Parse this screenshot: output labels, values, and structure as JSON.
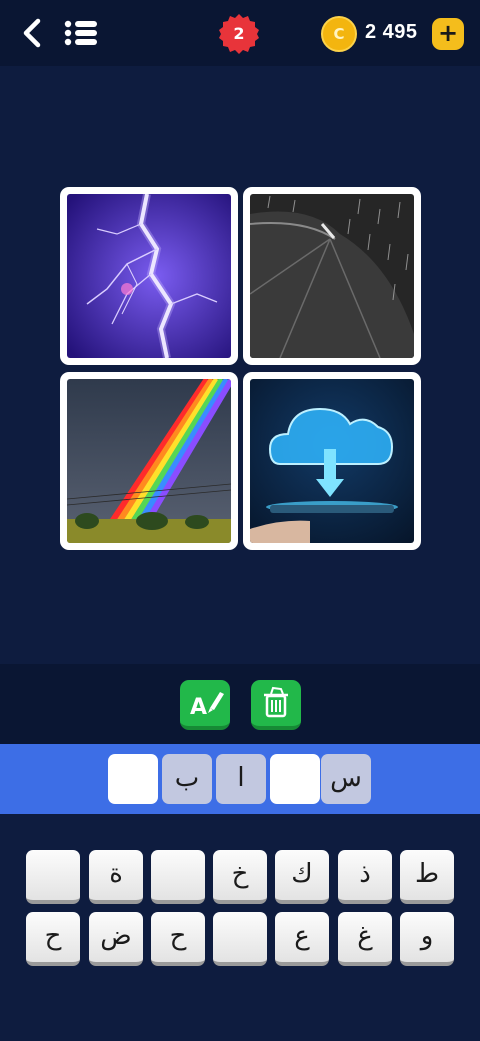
{
  "header": {
    "level": "2",
    "coins": "2 495",
    "plus_label": "+",
    "coin_symbol": "C"
  },
  "colors": {
    "background": "#0e1c3f",
    "bar": "#0a1633",
    "answer_bar": "#3d6ee6",
    "level_badge": "#e8343a",
    "coin": "#f3b50f",
    "hint_button": "#22b84a"
  },
  "images": [
    {
      "subject": "lightning"
    },
    {
      "subject": "umbrella-rain"
    },
    {
      "subject": "rainbow"
    },
    {
      "subject": "cloud-upload"
    }
  ],
  "tools": [
    {
      "icon": "reveal-letter-icon"
    },
    {
      "icon": "remove-letters-icon"
    }
  ],
  "answer": {
    "slots": [
      "",
      "ب",
      "ا",
      "",
      "س"
    ]
  },
  "keyboard": {
    "row1": [
      "",
      "ة",
      "",
      "خ",
      "ك",
      "ذ",
      "ط"
    ],
    "row2": [
      "ح",
      "ض",
      "ح",
      "",
      "ع",
      "غ",
      "و"
    ]
  }
}
